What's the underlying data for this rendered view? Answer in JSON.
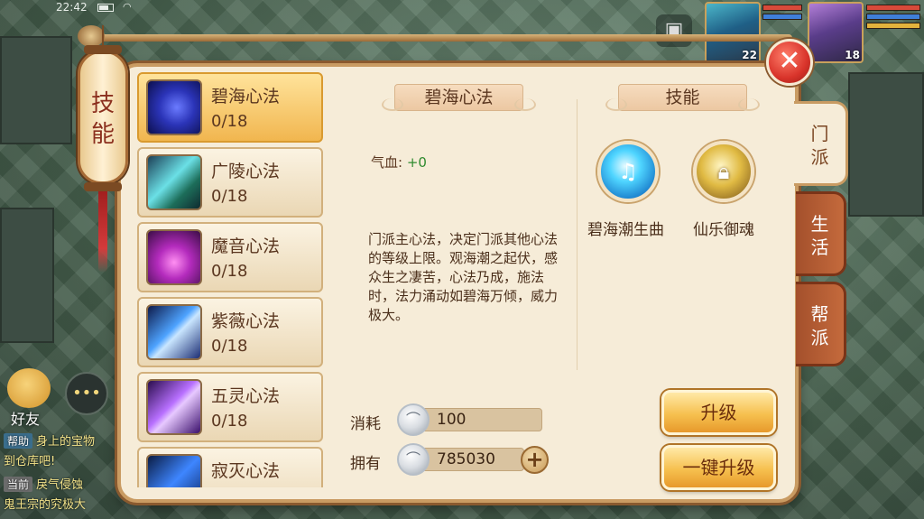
{
  "status_bar": {
    "time": "22:42"
  },
  "hud": {
    "portrait_levels": [
      "22",
      "18"
    ],
    "friends_label": "好友",
    "chat": [
      {
        "tag": "帮助",
        "text": "身上的宝物"
      },
      {
        "tag": "",
        "text": "到仓库吧!"
      },
      {
        "tag": "当前",
        "text": "戾气侵蚀"
      },
      {
        "tag": "",
        "text": "鬼王宗的究极大"
      }
    ]
  },
  "panel": {
    "title": "技能",
    "tabs": [
      "门派",
      "生活",
      "帮派"
    ],
    "active_tab_index": 0
  },
  "skills": [
    {
      "name": "碧海心法",
      "level": "0/18",
      "icon": "blue-swirl-icon",
      "selected": true
    },
    {
      "name": "广陵心法",
      "level": "0/18",
      "icon": "crystal-shard-icon",
      "selected": false
    },
    {
      "name": "魔音心法",
      "level": "0/18",
      "icon": "purple-lightning-icon",
      "selected": false
    },
    {
      "name": "紫薇心法",
      "level": "0/18",
      "icon": "blue-blades-icon",
      "selected": false
    },
    {
      "name": "五灵心法",
      "level": "0/18",
      "icon": "violet-blades-icon",
      "selected": false
    },
    {
      "name": "寂灭心法",
      "level": "",
      "icon": "blue-strike-icon",
      "selected": false
    }
  ],
  "detail": {
    "title": "碧海心法",
    "stat_label": "气血:",
    "stat_value": "+0",
    "description": "门派主心法，决定门派其他心法的等级上限。观海潮之起伏，感众生之凄苦，心法乃成，施法时，法力涌动如碧海万倾，威力极大。"
  },
  "sub_skills": {
    "title": "技能",
    "items": [
      {
        "name": "碧海潮生曲",
        "icon": "music-note-icon",
        "locked": false
      },
      {
        "name": "仙乐御魂",
        "icon": "lock-icon",
        "locked": true
      }
    ]
  },
  "cost": {
    "consume_label": "消耗",
    "consume_value": "100",
    "own_label": "拥有",
    "own_value": "785030",
    "currency_icon": "silver-coin-icon"
  },
  "buttons": {
    "upgrade": "升级",
    "one_click_upgrade": "一键升级"
  },
  "colors": {
    "panel_bg": "#f6ecd8",
    "selected_row": "#f1b64f",
    "stat_positive": "#2f8a2f",
    "close_red": "#d8332a"
  }
}
